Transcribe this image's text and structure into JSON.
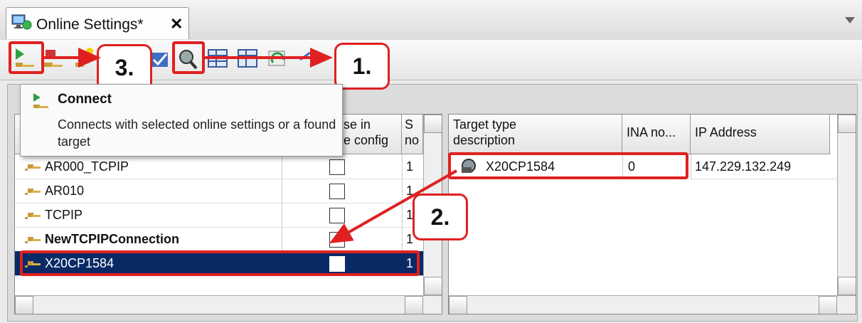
{
  "tab": {
    "title": "Online Settings*",
    "close_label": "✕"
  },
  "toolbar": {
    "icons": [
      "connect-icon",
      "disconnect-icon",
      "new-connection-icon",
      "check-icon",
      "browse-targets-icon",
      "grid-icon",
      "grid2-icon",
      "refresh-icon",
      "arrows-icon"
    ]
  },
  "callouts": {
    "one": "1.",
    "two": "2.",
    "three": "3."
  },
  "tooltip": {
    "title": "Connect",
    "description": "Connects with selected online settings or a found target"
  },
  "connections": {
    "headers": {
      "use_in_config": "Use in\nactive config",
      "sn": "S\nno"
    },
    "header_visible": {
      "use": "se in",
      "use2": "e config",
      "sn1": "S",
      "sn2": "no"
    },
    "rows": [
      {
        "name": "AR000_TCPIP",
        "bold": false,
        "checked": false,
        "sn": "1"
      },
      {
        "name": "AR010",
        "bold": false,
        "checked": false,
        "sn": "1"
      },
      {
        "name": "TCPIP",
        "bold": false,
        "checked": false,
        "sn": "1"
      },
      {
        "name": "NewTCPIPConnection",
        "bold": true,
        "checked": false,
        "sn": "1"
      },
      {
        "name": "X20CP1584",
        "bold": false,
        "checked": false,
        "sn": "1",
        "selected": true
      }
    ]
  },
  "targets": {
    "headers": {
      "type": "Target type\ndescription",
      "type1": "Target type",
      "type2": "description",
      "ina": "INA no...",
      "ip": "IP Address"
    },
    "rows": [
      {
        "type": "X20CP1584",
        "ina": "0",
        "ip": "147.229.132.249"
      }
    ]
  },
  "colors": {
    "highlight": "#e02020",
    "selection": "#0a2a66"
  }
}
